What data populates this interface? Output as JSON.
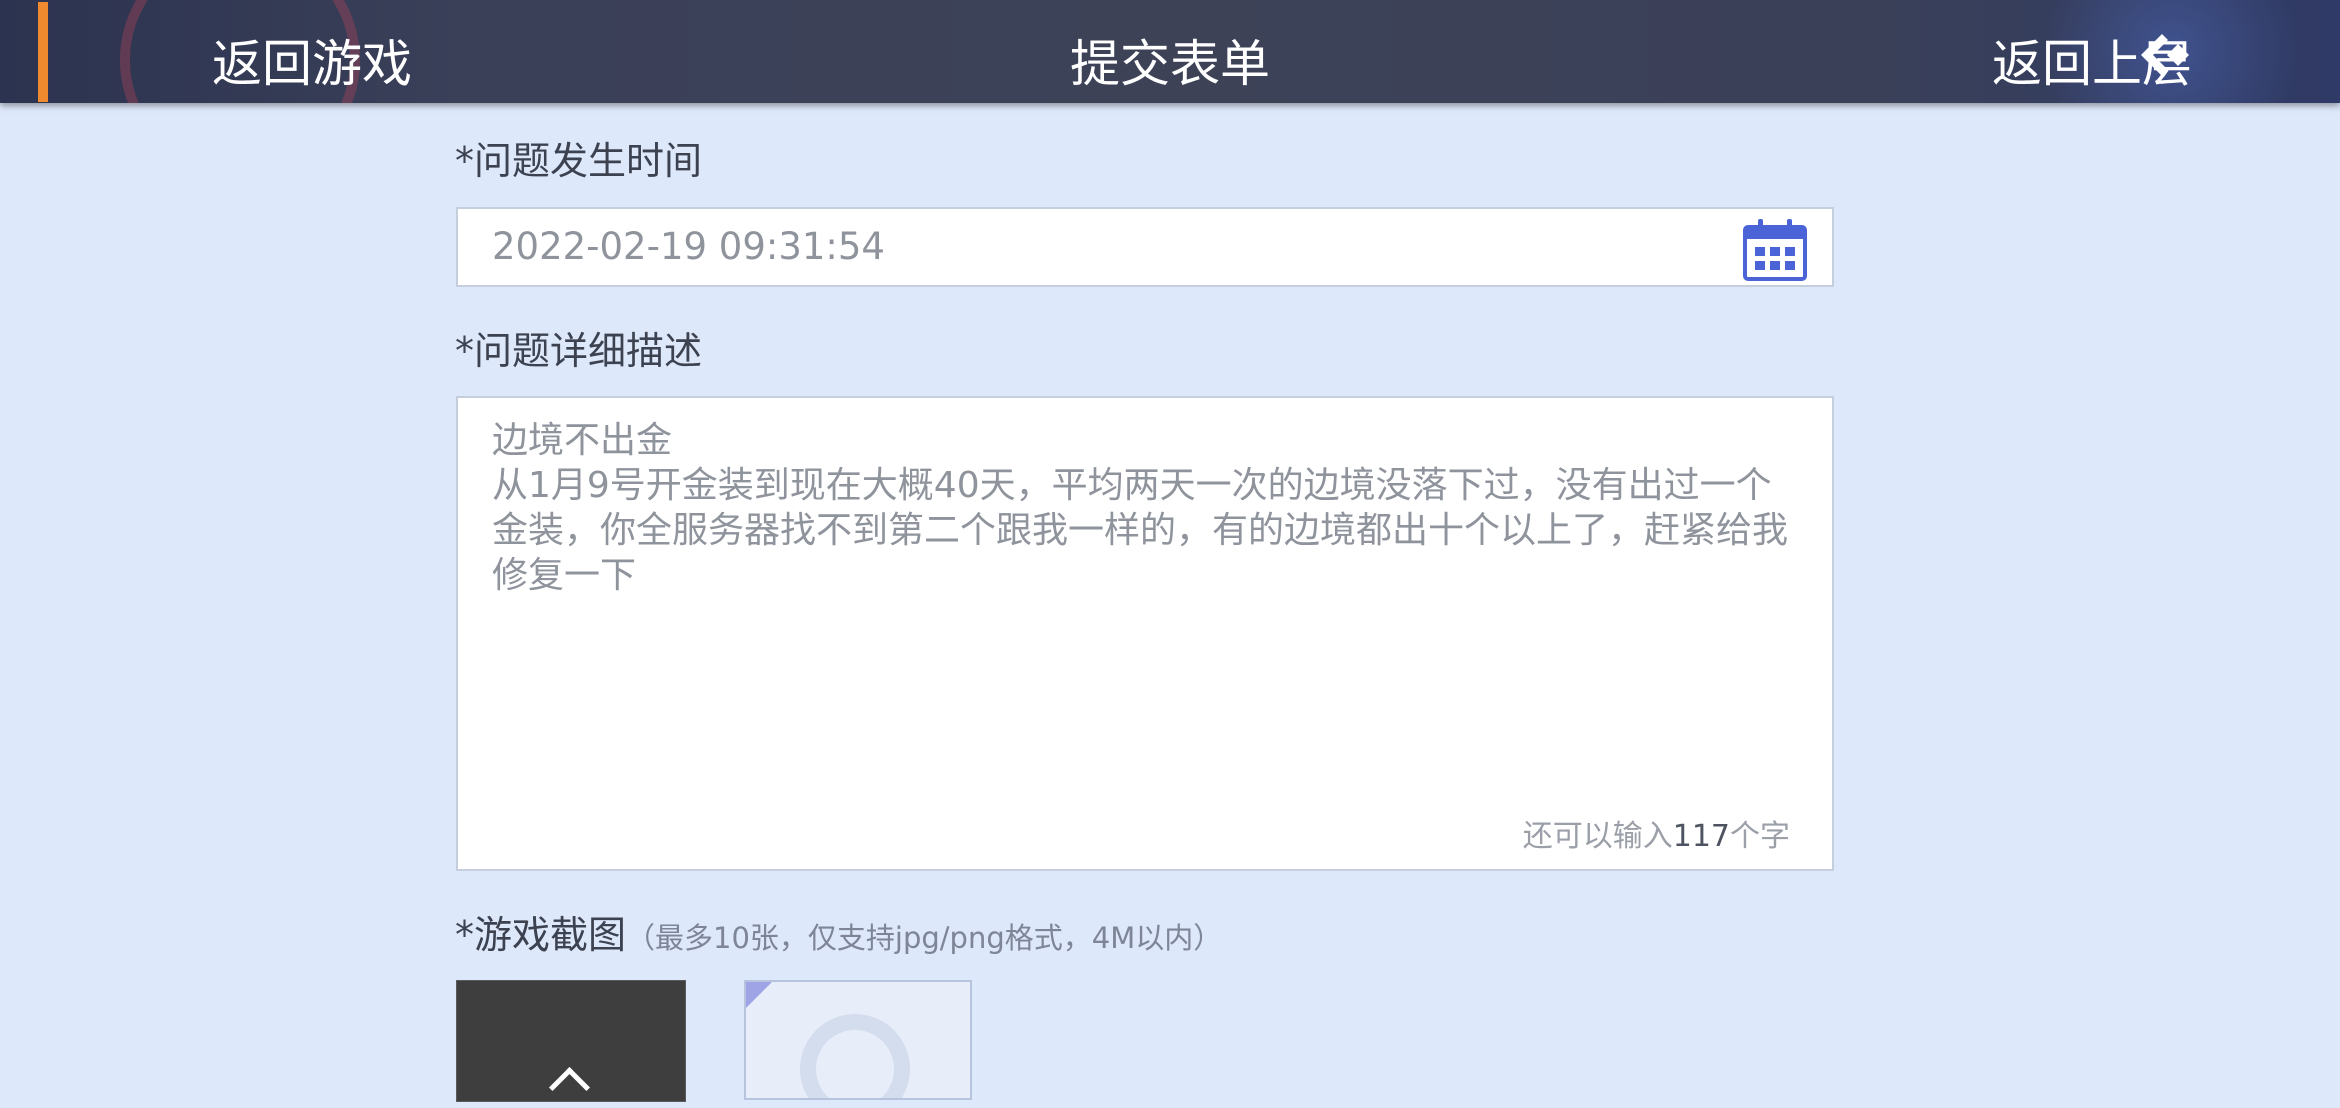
{
  "header": {
    "back_game_label": "返回游戏",
    "title": "提交表单",
    "back_up_label": "返回上层",
    "accent_color": "#f08a2e"
  },
  "form": {
    "time_label": "*问题发生时间",
    "time_value": "2022-02-19 09:31:54",
    "calendar_icon": "calendar-icon",
    "desc_label": "*问题详细描述",
    "desc_value": "边境不出金\n从1月9号开金装到现在大概40天，平均两天一次的边境没落下过，没有出过一个金装，你全服务器找不到第二个跟我一样的，有的边境都出十个以上了，赶紧给我修复一下",
    "counter_prefix": "还可以输入",
    "counter_num": "117",
    "counter_suffix": "个字",
    "screenshot_label": "*游戏截图",
    "screenshot_hint": "（最多10张，仅支持jpg/png格式，4M以内）"
  },
  "colors": {
    "page_bg": "#dde8fa",
    "calendar_blue": "#4a63d6"
  }
}
